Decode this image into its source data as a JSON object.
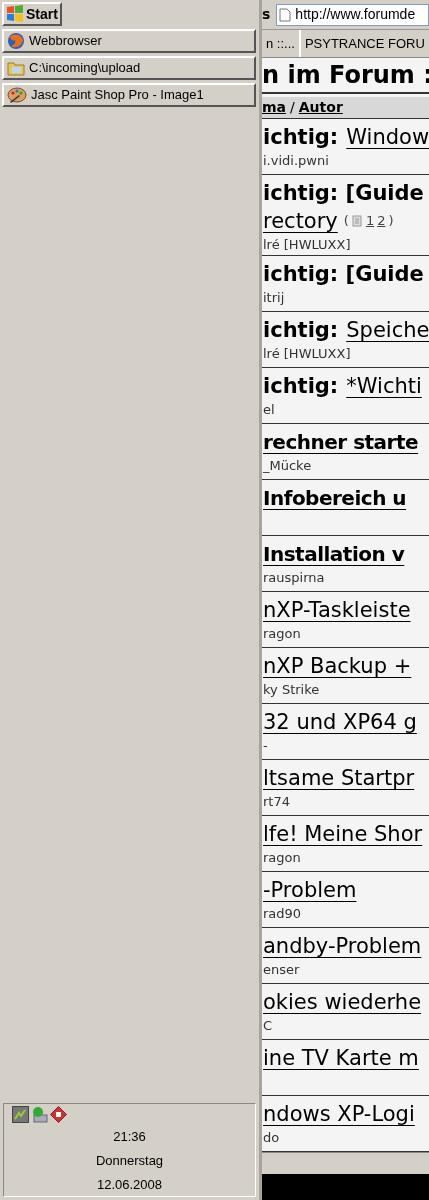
{
  "taskbar": {
    "start": "Start",
    "tasks": [
      {
        "kind": "browser",
        "label": "Webbrowser"
      },
      {
        "kind": "folder",
        "label": "C:\\incoming\\upload"
      },
      {
        "kind": "paint",
        "label": "Jasc Paint Shop Pro - Image1"
      }
    ],
    "tray": {
      "time": "21:36",
      "day": "Donnerstag",
      "date": "12.06.2008"
    }
  },
  "browser": {
    "toolbar_label": "s",
    "address": "http://www.forumde",
    "tabs": [
      "n ::...",
      "PSYTRANCE FORU"
    ],
    "heading": "n im Forum :",
    "column_header": {
      "topic": "ma",
      "separator": "/",
      "author": "Autor"
    },
    "topics": [
      {
        "kind": "sticky",
        "prefix": "ichtig:",
        "title": "Window",
        "author": "i.vidi.pwni"
      },
      {
        "kind": "sticky_bold",
        "prefix": "ichtig: [Guide",
        "title": "rectory",
        "pages_open": "(",
        "pages": [
          "1",
          "2"
        ],
        "pages_close": ")",
        "author": "lré [HWLUXX]"
      },
      {
        "kind": "sticky_bold",
        "prefix": "ichtig: [Guide",
        "author": "itrij"
      },
      {
        "kind": "sticky",
        "prefix": "ichtig:",
        "title": "Speiche",
        "author": "lré [HWLUXX]"
      },
      {
        "kind": "sticky",
        "prefix": "ichtig:",
        "title": "*Wichti",
        "author": "el"
      },
      {
        "kind": "bold",
        "title": "rechner starte",
        "author": "_Mücke"
      },
      {
        "kind": "bold",
        "title": "Infobereich u"
      },
      {
        "kind": "bold",
        "title": "Installation v",
        "author": "rauspirna"
      },
      {
        "kind": "normal",
        "title": "nXP-Taskleiste",
        "author": "ragon"
      },
      {
        "kind": "normal",
        "title": "nXP Backup +",
        "author": "ky Strike"
      },
      {
        "kind": "normal",
        "title": "32 und XP64 g",
        "author": "-"
      },
      {
        "kind": "normal",
        "title": "ltsame Startpr",
        "author": "rt74"
      },
      {
        "kind": "normal",
        "title": "lfe! Meine Shor",
        "author": "ragon"
      },
      {
        "kind": "normal",
        "title": "-Problem",
        "author": "rad90"
      },
      {
        "kind": "normal",
        "title": "andby-Problem",
        "author": "enser"
      },
      {
        "kind": "normal",
        "title": "okies wiederhe",
        "author": "C"
      },
      {
        "kind": "normal",
        "title": "ine TV Karte m"
      },
      {
        "kind": "normal",
        "title": "ndows XP-Logi",
        "author": "do"
      }
    ]
  }
}
